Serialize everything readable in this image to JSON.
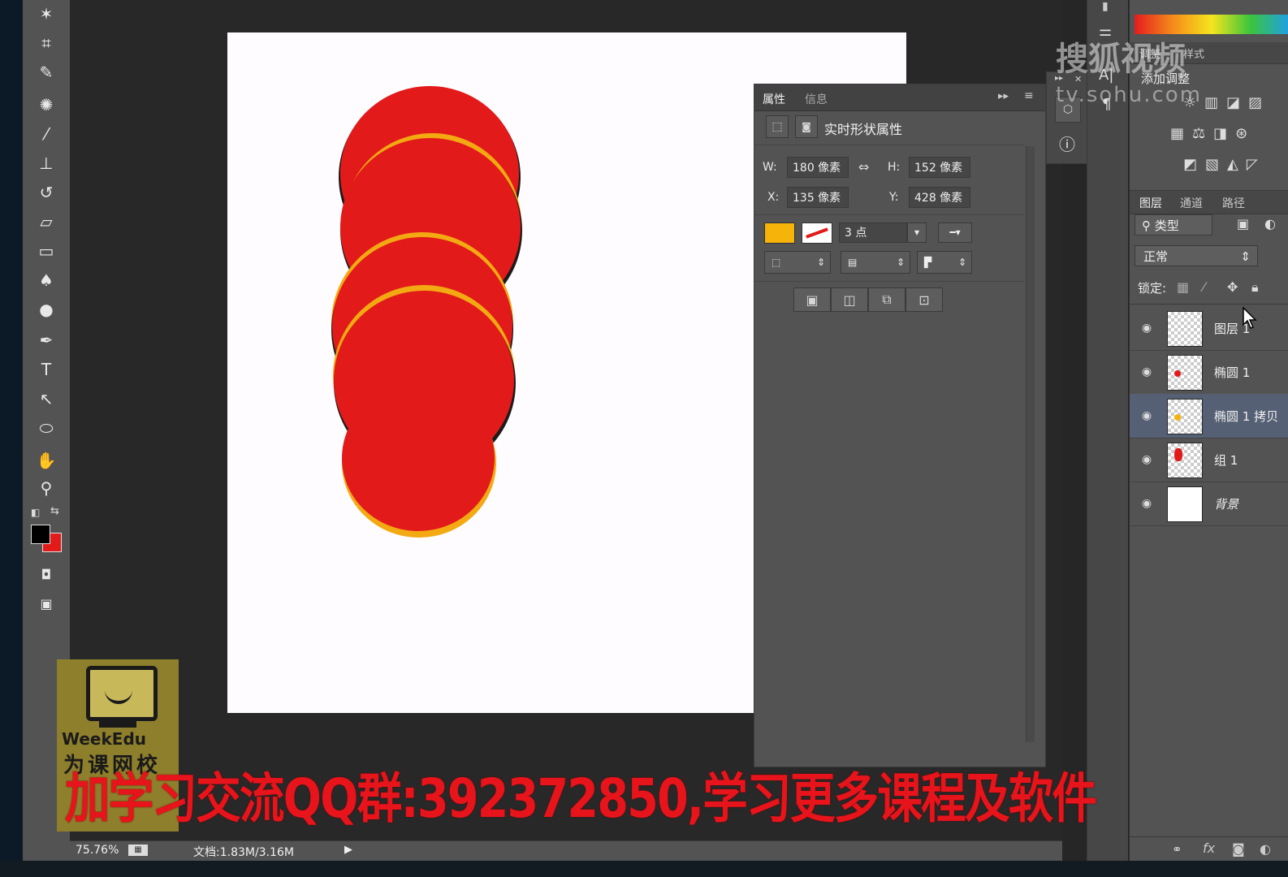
{
  "status": {
    "zoom": "75.76%",
    "doc": "文档:1.83M/3.16M"
  },
  "properties": {
    "tabs": [
      "属性",
      "信息"
    ],
    "section_title": "实时形状属性",
    "w_label": "W:",
    "w_value": "180 像素",
    "h_label": "H:",
    "h_value": "152 像素",
    "x_label": "X:",
    "x_value": "135 像素",
    "y_label": "Y:",
    "y_value": "428 像素",
    "stroke_width": "3 点",
    "fill_color": "#f6b40b",
    "stroke_color": "#e21a1a"
  },
  "adjustments": {
    "tabs": [
      "调整",
      "样式"
    ],
    "add_label": "添加调整"
  },
  "layers_panel": {
    "tabs": [
      "图层",
      "通道",
      "路径"
    ],
    "filter_label": "类型",
    "blend_mode": "正常",
    "lock_label": "锁定:",
    "layers": [
      {
        "name": "图层 1"
      },
      {
        "name": "椭圆 1"
      },
      {
        "name": "椭圆 1 拷贝"
      },
      {
        "name": "组 1"
      },
      {
        "name": "背景"
      }
    ]
  },
  "overlay": {
    "qq_banner": "加学习交流QQ群:392372850,学习更多课程及软件",
    "watermark_cn": "搜狐视频",
    "watermark_url": "tv.sohu.com",
    "logo_text": "WeekEdu",
    "logo_sub": "为课网校"
  },
  "colors": {
    "ellipse_red": "#e21a1a",
    "ellipse_orange": "#f6b40b",
    "foreground": "#000000",
    "background": "#e21a1a"
  }
}
